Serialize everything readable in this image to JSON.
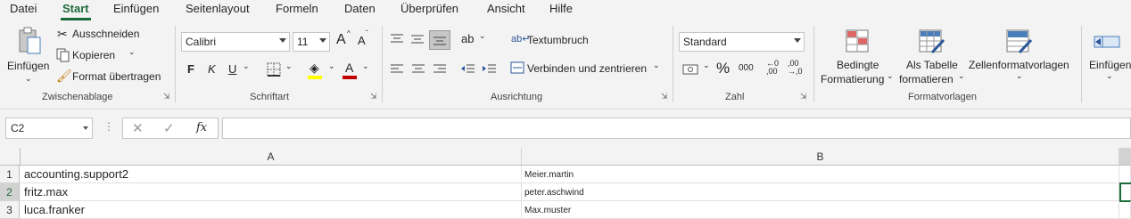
{
  "menu": {
    "tabs": [
      "Datei",
      "Start",
      "Einfügen",
      "Seitenlayout",
      "Formeln",
      "Daten",
      "Überprüfen",
      "Ansicht",
      "Hilfe"
    ],
    "active": "Start"
  },
  "ribbon": {
    "clipboard": {
      "paste_label": "Einfügen",
      "cut_label": "Ausschneiden",
      "copy_label": "Kopieren",
      "format_painter_label": "Format übertragen",
      "group_label": "Zwischenablage"
    },
    "font": {
      "font_name": "Calibri",
      "font_size": "11",
      "bold": "F",
      "italic": "K",
      "underline": "U",
      "grow": "A",
      "shrink": "A",
      "font_color_letter": "A",
      "group_label": "Schriftart"
    },
    "alignment": {
      "wrap_text_label": "Textumbruch",
      "merge_label": "Verbinden und zentrieren",
      "group_label": "Ausrichtung"
    },
    "number": {
      "format_value": "Standard",
      "percent": "%",
      "thousands": "000",
      "group_label": "Zahl"
    },
    "styles": {
      "conditional_line1": "Bedingte",
      "conditional_line2": "Formatierung",
      "table_line1": "Als Tabelle",
      "table_line2": "formatieren",
      "cellstyles_label": "Zellenformatvorlagen",
      "group_label": "Formatvorlagen"
    },
    "cells": {
      "insert_label": "Einfügen"
    }
  },
  "formula_bar": {
    "name_box": "C2",
    "fx": "fx",
    "formula": ""
  },
  "sheet": {
    "columns": [
      "A",
      "B"
    ],
    "rows": [
      {
        "num": "1",
        "a": "accounting.support2",
        "b": "Meier.martin"
      },
      {
        "num": "2",
        "a": "fritz.max",
        "b": "peter.aschwind"
      },
      {
        "num": "3",
        "a": "luca.franker",
        "b": "Max.muster"
      }
    ]
  },
  "colors": {
    "accent": "#1d6b3a",
    "font_color_bar": "#c00000",
    "highlight_bar": "#ffff00"
  }
}
